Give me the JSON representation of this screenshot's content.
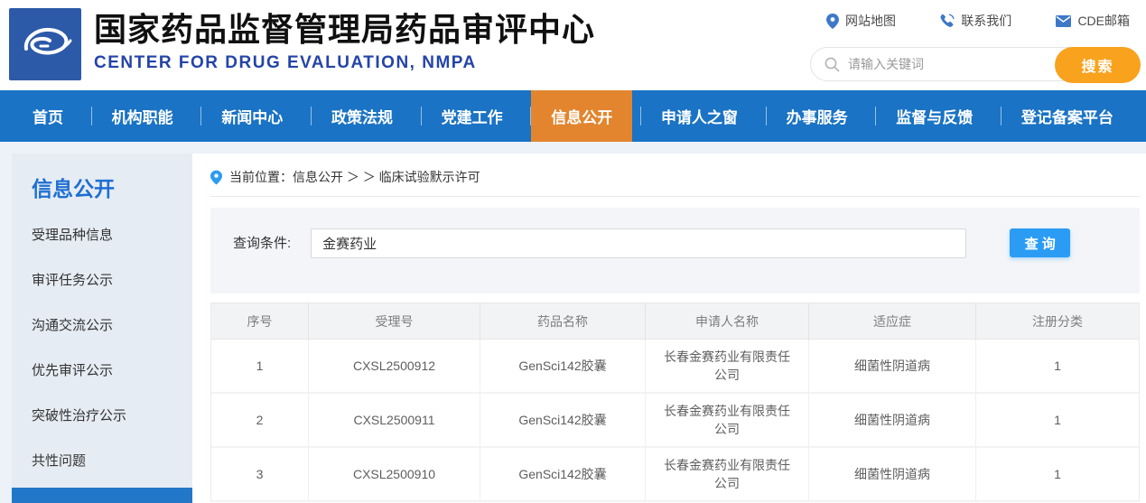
{
  "header": {
    "title": "国家药品监督管理局药品审评中心",
    "subtitle": "CENTER FOR DRUG EVALUATION, NMPA",
    "quick_links": [
      {
        "icon": "location-pin-icon",
        "label": "网站地图"
      },
      {
        "icon": "phone-icon",
        "label": "联系我们"
      },
      {
        "icon": "envelope-icon",
        "label": "CDE邮箱"
      }
    ],
    "search": {
      "placeholder": "请输入关键词",
      "button_label": "搜索"
    }
  },
  "nav": {
    "items": [
      {
        "label": "首页",
        "active": false
      },
      {
        "label": "机构职能",
        "active": false
      },
      {
        "label": "新闻中心",
        "active": false
      },
      {
        "label": "政策法规",
        "active": false
      },
      {
        "label": "党建工作",
        "active": false
      },
      {
        "label": "信息公开",
        "active": true
      },
      {
        "label": "申请人之窗",
        "active": false
      },
      {
        "label": "办事服务",
        "active": false
      },
      {
        "label": "监督与反馈",
        "active": false
      },
      {
        "label": "登记备案平台",
        "active": false
      }
    ]
  },
  "sidebar": {
    "title": "信息公开",
    "items": [
      "受理品种信息",
      "审评任务公示",
      "沟通交流公示",
      "优先审评公示",
      "突破性治疗公示",
      "共性问题"
    ]
  },
  "breadcrumb": {
    "text": "当前位置：信息公开 ＞ ＞ 临床试验默示许可"
  },
  "query": {
    "label": "查询条件:",
    "value": "金赛药业",
    "button_label": "查 询"
  },
  "table": {
    "columns": [
      "序号",
      "受理号",
      "药品名称",
      "申请人名称",
      "适应症",
      "注册分类"
    ],
    "rows": [
      [
        "1",
        "CXSL2500912",
        "GenSci142胶囊",
        "长春金赛药业有限责任公司",
        "细菌性阴道病",
        "1"
      ],
      [
        "2",
        "CXSL2500911",
        "GenSci142胶囊",
        "长春金赛药业有限责任公司",
        "细菌性阴道病",
        "1"
      ],
      [
        "3",
        "CXSL2500910",
        "GenSci142胶囊",
        "长春金赛药业有限责任公司",
        "细菌性阴道病",
        "1"
      ]
    ]
  },
  "colors": {
    "nav_blue": "#1a73c4",
    "nav_active_orange": "#e2852e",
    "search_button_orange": "#f9a21d",
    "query_button_blue": "#2b9cf4",
    "sidebar_bg": "#e6ecf3",
    "sidebar_title_blue": "#1e6fd2",
    "logo_blue": "#2c5aa8",
    "subtitle_blue": "#2444a8",
    "page_tint": "#edf2f8"
  }
}
